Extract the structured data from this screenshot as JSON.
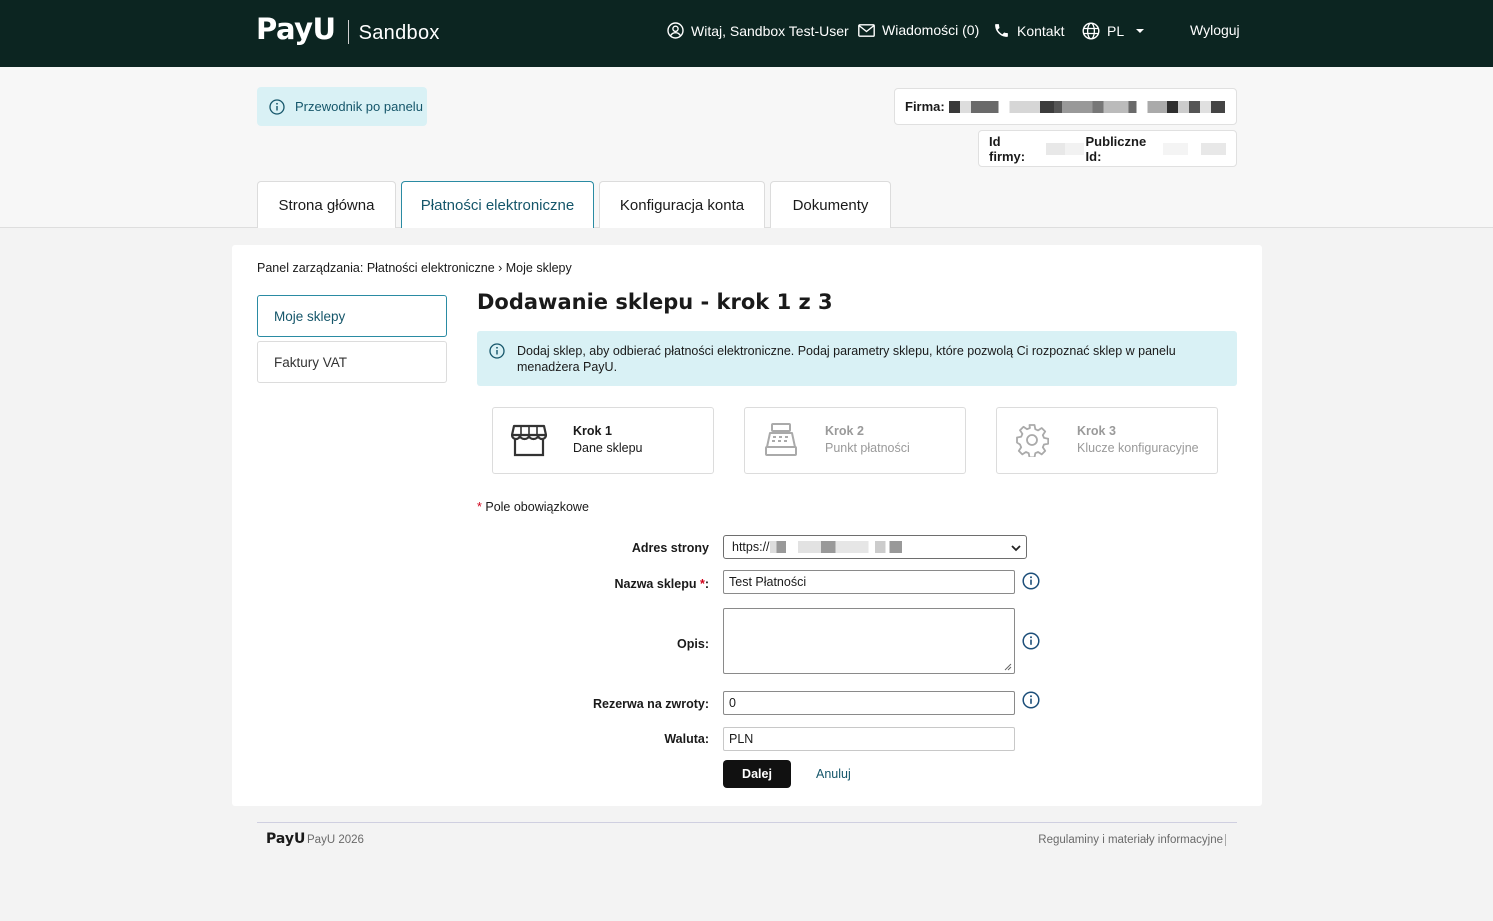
{
  "header": {
    "logo": "PayU",
    "logo_sub": "Sandbox",
    "user_greeting": "Witaj, Sandbox Test-User",
    "messages": "Wiadomości (0)",
    "contact": "Kontakt",
    "language": "PL",
    "logout": "Wyloguj"
  },
  "guide_label": "Przewodnik po panelu",
  "company": {
    "firma_label": "Firma:",
    "id_label": "Id firmy:",
    "public_id_label": "Publiczne Id:"
  },
  "tabs": [
    {
      "label": "Strona główna"
    },
    {
      "label": "Płatności elektroniczne"
    },
    {
      "label": "Konfiguracja konta"
    },
    {
      "label": "Dokumenty"
    }
  ],
  "breadcrumb": {
    "prefix": "Panel zarządzania:",
    "path": "Płatności elektroniczne › Moje sklepy"
  },
  "sidebar": {
    "items": [
      {
        "label": "Moje sklepy"
      },
      {
        "label": "Faktury VAT"
      }
    ]
  },
  "page_title": "Dodawanie sklepu - krok 1 z 3",
  "info_text": "Dodaj sklep, aby odbierać płatności elektroniczne. Podaj parametry sklepu, które pozwolą Ci rozpoznać sklep w panelu menadżera PayU.",
  "steps": [
    {
      "title": "Krok 1",
      "subtitle": "Dane sklepu",
      "icon": "storefront-icon"
    },
    {
      "title": "Krok 2",
      "subtitle": "Punkt płatności",
      "icon": "cash-register-icon"
    },
    {
      "title": "Krok 3",
      "subtitle": "Klucze konfiguracyjne",
      "icon": "gear-icon"
    }
  ],
  "required_note": "Pole obowiązkowe",
  "form": {
    "address_label": "Adres strony",
    "address_value": "https://",
    "name_label": "Nazwa sklepu",
    "name_value": "Test Płatności",
    "description_label": "Opis:",
    "description_value": "",
    "reserve_label": "Rezerwa na zwroty:",
    "reserve_value": "0",
    "currency_label": "Waluta:",
    "currency_value": "PLN"
  },
  "buttons": {
    "next": "Dalej",
    "cancel": "Anuluj"
  },
  "footer": {
    "logo": "PayU",
    "copyright": "PayU 2026",
    "link": "Regulaminy i materiały informacyjne"
  },
  "colors": {
    "header_bg": "#0c2521",
    "accent": "#2a8ba3",
    "info_bg": "#d9f1f5",
    "primary_button": "#111111",
    "required": "#d0021b"
  }
}
